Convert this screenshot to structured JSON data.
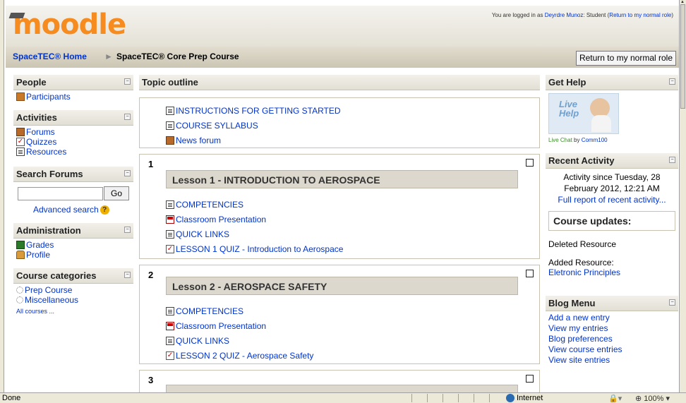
{
  "header": {
    "logo": "moodle",
    "login_prefix": "You are logged in as ",
    "user_name": "Deyrdre Munoz",
    "login_role": ": Student (",
    "return_link": "Return to my normal role",
    "login_suffix": ")"
  },
  "navbar": {
    "home": "SpaceTEC® Home",
    "separator": "►",
    "course": "SpaceTEC® Core Prep Course",
    "return_button": "Return to my normal role"
  },
  "left": {
    "people": {
      "title": "People",
      "items": [
        "Participants"
      ]
    },
    "activities": {
      "title": "Activities",
      "items": [
        "Forums",
        "Quizzes",
        "Resources"
      ]
    },
    "search": {
      "title": "Search Forums",
      "go": "Go",
      "advanced": "Advanced search"
    },
    "admin": {
      "title": "Administration",
      "items": [
        "Grades",
        "Profile"
      ]
    },
    "categories": {
      "title": "Course categories",
      "items": [
        "Prep Course",
        "Miscellaneous"
      ],
      "all": "All courses ..."
    }
  },
  "main": {
    "outline_title": "Topic outline",
    "intro_items": [
      "INSTRUCTIONS FOR GETTING STARTED",
      "COURSE SYLLABUS",
      "News forum"
    ],
    "sections": [
      {
        "number": "1",
        "title": "Lesson 1 - INTRODUCTION TO AEROSPACE",
        "items": [
          "COMPETENCIES",
          "Classroom Presentation",
          "QUICK LINKS",
          "LESSON 1 QUIZ - Introduction to Aerospace"
        ]
      },
      {
        "number": "2",
        "title": "Lesson 2 - AEROSPACE SAFETY",
        "items": [
          "COMPETENCIES",
          "Classroom Presentation",
          "QUICK LINKS",
          "LESSON 2 QUIZ - Aerospace Safety"
        ]
      },
      {
        "number": "3"
      }
    ]
  },
  "right": {
    "help": {
      "title": "Get Help",
      "live_line1": "Live",
      "live_line2": "Help",
      "live_chat": "Live Chat",
      "by": " by ",
      "provider": "Comm100"
    },
    "recent": {
      "title": "Recent Activity",
      "since": "Activity since Tuesday, 28 February 2012, 12:21 AM",
      "full_report": "Full report of recent activity...",
      "updates_title": "Course updates:",
      "deleted": "Deleted Resource",
      "added": "Added Resource:",
      "added_item": "Eletronic Principles"
    },
    "blog": {
      "title": "Blog Menu",
      "items": [
        "Add a new entry",
        "View my entries",
        "Blog preferences",
        "View course entries",
        "View site entries"
      ]
    }
  },
  "statusbar": {
    "done": "Done",
    "zone": "Internet",
    "zoom": "100%"
  },
  "icons": {
    "participants": "people-icon",
    "forums": "forum-icon",
    "quizzes": "quiz-icon",
    "resources": "resource-icon",
    "grades": "grades-icon",
    "profile": "profile-icon",
    "category": "category-icon",
    "help": "help-icon",
    "pdf": "pdf-icon",
    "globe": "globe-icon"
  },
  "colors": {
    "logo": "#f68b1f",
    "link": "#0033cc",
    "header_bg": "#e4e1d6",
    "section_title_bg": "#dcd8cd"
  }
}
